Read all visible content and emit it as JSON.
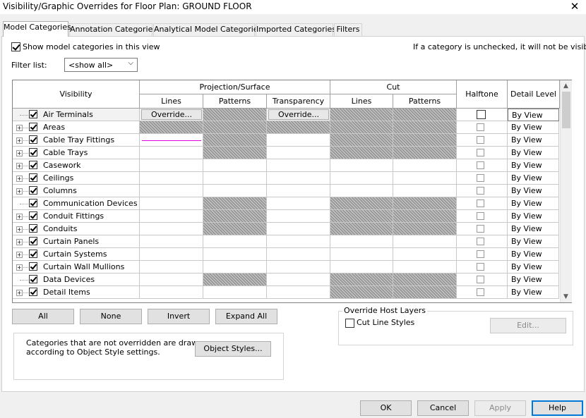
{
  "window": {
    "title": "Visibility/Graphic Overrides for Floor Plan: GROUND FLOOR",
    "close": "✕"
  },
  "tabs": [
    {
      "label": "Model Categories",
      "active": true
    },
    {
      "label": "Annotation Categories",
      "active": false
    },
    {
      "label": "Analytical Model Categories",
      "active": false
    },
    {
      "label": "Imported Categories",
      "active": false
    },
    {
      "label": "Filters",
      "active": false
    }
  ],
  "show_model_categories": {
    "label": "Show model categories in this view",
    "checked": true
  },
  "hint": "If a category is unchecked, it will not be visible.",
  "filter": {
    "label": "Filter list:",
    "value": "<show all>"
  },
  "grid": {
    "headers": {
      "visibility": "Visibility",
      "projection": "Projection/Surface",
      "cut": "Cut",
      "halftone": "Halftone",
      "detail_level": "Detail Level",
      "lines": "Lines",
      "patterns": "Patterns",
      "transparency": "Transparency",
      "cut_lines": "Lines",
      "cut_patterns": "Patterns"
    },
    "override_label": "Override...",
    "rows": [
      {
        "name": "Air Terminals",
        "expandable": false,
        "checked": true,
        "detail": "By View",
        "selected": true
      },
      {
        "name": "Areas",
        "expandable": true,
        "checked": true,
        "detail": "By View"
      },
      {
        "name": "Cable Tray Fittings",
        "expandable": true,
        "checked": true,
        "detail": "By View"
      },
      {
        "name": "Cable Trays",
        "expandable": true,
        "checked": true,
        "detail": "By View"
      },
      {
        "name": "Casework",
        "expandable": true,
        "checked": true,
        "detail": "By View"
      },
      {
        "name": "Ceilings",
        "expandable": true,
        "checked": true,
        "detail": "By View"
      },
      {
        "name": "Columns",
        "expandable": true,
        "checked": true,
        "detail": "By View"
      },
      {
        "name": "Communication Devices",
        "expandable": false,
        "checked": true,
        "detail": "By View"
      },
      {
        "name": "Conduit Fittings",
        "expandable": true,
        "checked": true,
        "detail": "By View"
      },
      {
        "name": "Conduits",
        "expandable": true,
        "checked": true,
        "detail": "By View"
      },
      {
        "name": "Curtain Panels",
        "expandable": true,
        "checked": true,
        "detail": "By View"
      },
      {
        "name": "Curtain Systems",
        "expandable": true,
        "checked": true,
        "detail": "By View"
      },
      {
        "name": "Curtain Wall Mullions",
        "expandable": true,
        "checked": true,
        "detail": "By View"
      },
      {
        "name": "Data Devices",
        "expandable": false,
        "checked": true,
        "detail": "By View"
      },
      {
        "name": "Detail Items",
        "expandable": true,
        "checked": true,
        "detail": "By View"
      }
    ]
  },
  "buttons": {
    "all": "All",
    "none": "None",
    "invert": "Invert",
    "expand_all": "Expand All",
    "object_styles": "Object Styles...",
    "edit": "Edit...",
    "ok": "OK",
    "cancel": "Cancel",
    "apply": "Apply",
    "help": "Help"
  },
  "override_host": {
    "title": "Override Host Layers",
    "cut_line_styles": "Cut Line Styles"
  },
  "note": {
    "line1": "Categories that are not overridden are drawn",
    "line2": "according to Object Style settings."
  },
  "colors": {
    "accent": "#0078d7",
    "line_override": "#e000e0"
  }
}
